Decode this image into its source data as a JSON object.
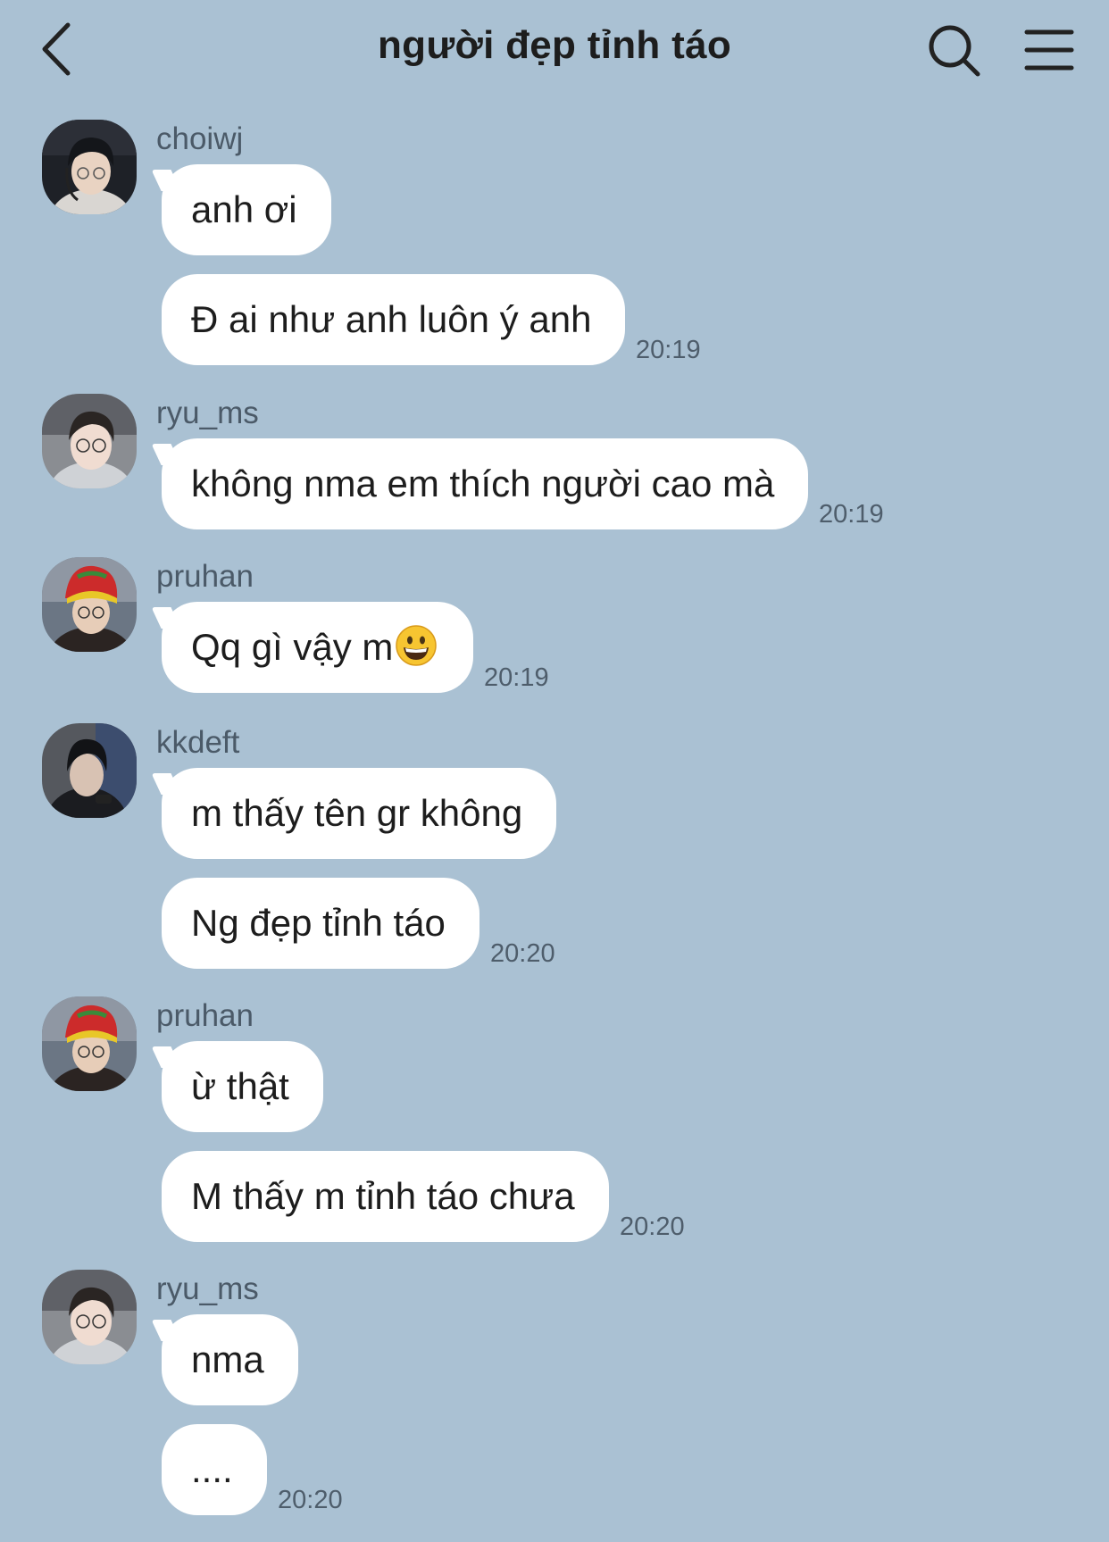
{
  "header": {
    "title": "người đẹp tỉnh táo",
    "back_icon": "chevron-left-icon",
    "search_icon": "search-icon",
    "menu_icon": "hamburger-menu-icon"
  },
  "messages": [
    {
      "sender": "choiwj",
      "bubbles": [
        "anh ơi",
        "Đ ai như anh luôn ý anh"
      ],
      "time": "20:19"
    },
    {
      "sender": "ryu_ms",
      "bubbles": [
        "không nma em thích người cao mà"
      ],
      "time": "20:19"
    },
    {
      "sender": "pruhan",
      "bubbles": [
        "Qq gì vậy m"
      ],
      "emoji": "grinning-face-emoji",
      "time": "20:19"
    },
    {
      "sender": "kkdeft",
      "bubbles": [
        "m thấy tên gr không",
        "Ng đẹp tỉnh táo"
      ],
      "time": "20:20"
    },
    {
      "sender": "pruhan",
      "bubbles": [
        "ừ thật",
        "M thấy m tỉnh táo chưa"
      ],
      "time": "20:20"
    },
    {
      "sender": "ryu_ms",
      "bubbles": [
        "nma",
        "...."
      ],
      "time": "20:20"
    }
  ],
  "colors": {
    "background": "#aac1d3",
    "bubble": "#ffffff",
    "text": "#1d1d1d",
    "secondary_text": "#4b5a68"
  }
}
